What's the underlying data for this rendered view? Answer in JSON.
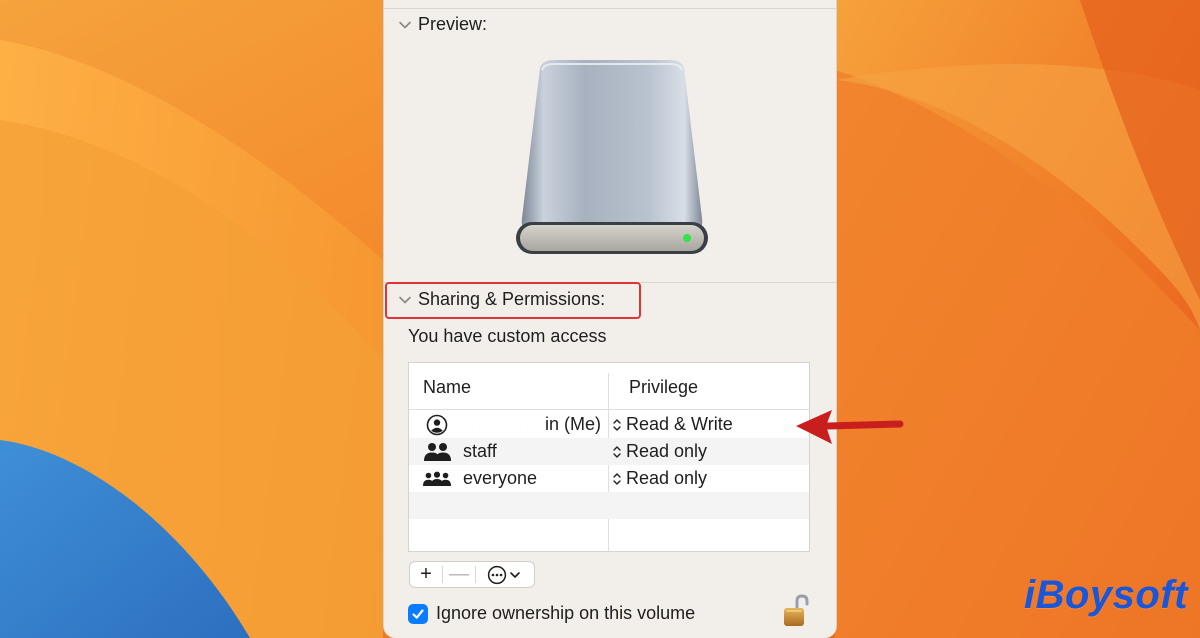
{
  "colors": {
    "panel_bg": "#f2eeea",
    "highlight": "#e0333a",
    "checkbox_accent": "#0a7cff",
    "arrow": "#c81e1e",
    "brand": "#1a56d6"
  },
  "preview": {
    "title": "Preview:",
    "icon": "external-drive-icon"
  },
  "sharing": {
    "title": "Sharing & Permissions:",
    "access_text": "You have custom access",
    "columns": {
      "name": "Name",
      "privilege": "Privilege"
    },
    "rows": [
      {
        "icon": "person-icon",
        "name": "in (Me)",
        "privilege": "Read & Write"
      },
      {
        "icon": "group-icon",
        "name": "staff",
        "privilege": "Read only"
      },
      {
        "icon": "everyone-icon",
        "name": "everyone",
        "privilege": "Read only"
      }
    ]
  },
  "toolbar": {
    "add": "+",
    "remove": "—",
    "action_icon": "ellipsis-circle-icon"
  },
  "options": {
    "ignore_ownership_label": "Ignore ownership on this volume",
    "ignore_ownership_checked": true,
    "lock_icon": "padlock-unlocked-icon"
  },
  "brand": {
    "watermark": "iBoysoft"
  }
}
